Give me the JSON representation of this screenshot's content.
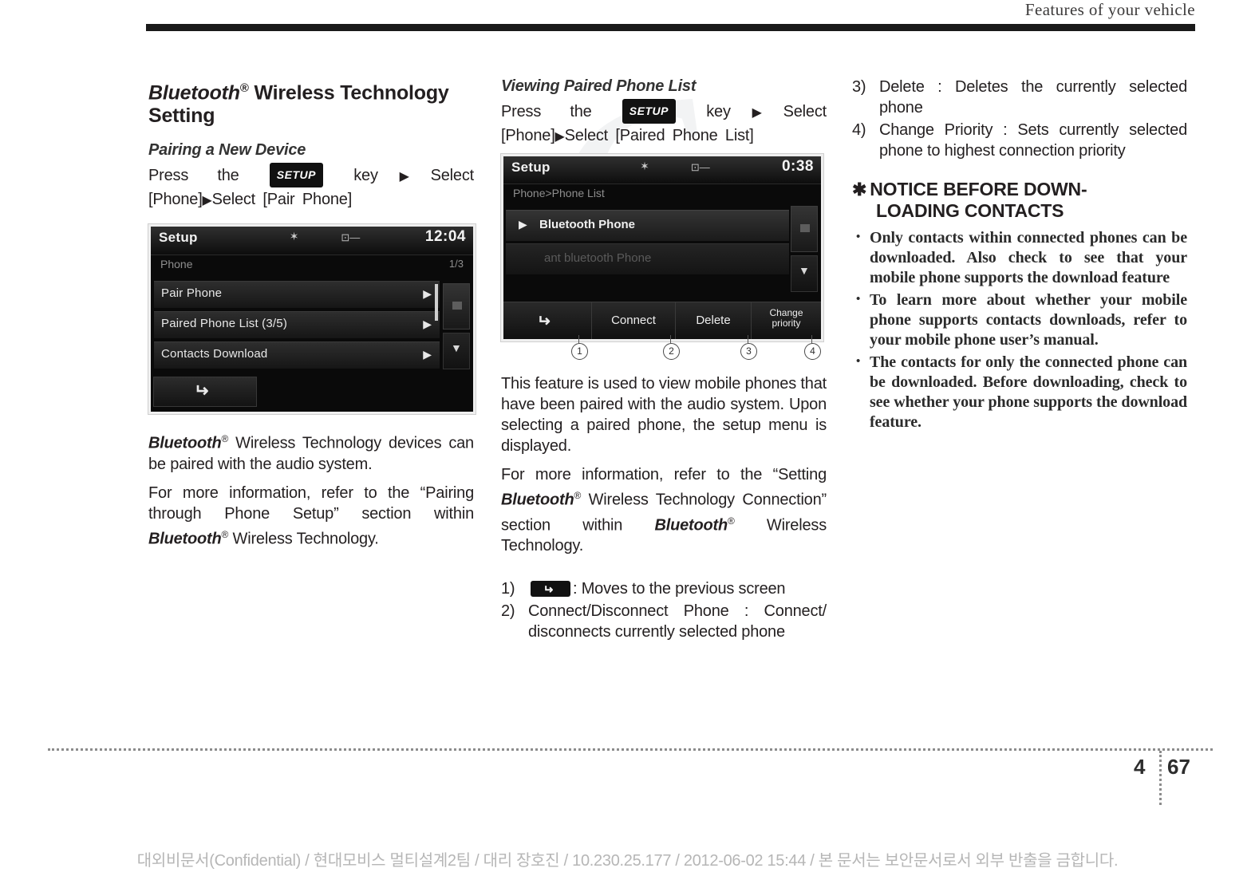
{
  "header": {
    "title": "Features of your vehicle"
  },
  "watermark": {
    "text": "G"
  },
  "col1": {
    "section_title_part1": "Bluetooth",
    "section_title_reg": "®",
    "section_title_part2": " Wireless Technology Setting",
    "sub_title": "Pairing a New Device",
    "instruction": {
      "lead": "Press",
      "the": "the",
      "key_chip": "SETUP",
      "after_chip": "key",
      "arrow1": "▶",
      "select1": "Select [Phone]",
      "arrow2": "▶",
      "select2": "Select [Pair Phone]"
    },
    "screen": {
      "title": "Setup",
      "bt_icon": "bluetooth-icon",
      "usb_icon": "usb-icon",
      "clock": "12:04",
      "breadcrumb": "Phone",
      "page_indicator": "1/3",
      "rows": [
        {
          "label": "Pair Phone",
          "arrow": "▶"
        },
        {
          "label": "Paired Phone List (3/5)",
          "arrow": "▶"
        },
        {
          "label": "Contacts Download",
          "arrow": "▶"
        }
      ],
      "back_icon": "back-arrow-icon"
    },
    "para1": {
      "bt": "Bluetooth",
      "sup": "®",
      "rest": " Wireless Technology devices can be paired with the audio system."
    },
    "para2": {
      "a": "For more information, refer to the “Pairing through Phone Setup” section within ",
      "bt": "Bluetooth",
      "sup": "®",
      "b": " Wireless Technology."
    }
  },
  "col2": {
    "sub_title": "Viewing Paired Phone List",
    "instruction": {
      "lead": "Press",
      "the": "the",
      "key_chip": "SETUP",
      "after_chip": "key",
      "arrow1": "▶",
      "select1": "Select [Phone]",
      "arrow2": "▶",
      "select2": "Select [Paired Phone List]"
    },
    "screen": {
      "title": "Setup",
      "bt_icon": "bluetooth-icon",
      "usb_icon": "usb-icon",
      "clock": "0:38",
      "breadcrumb": "Phone>Phone List",
      "rows": [
        {
          "tri": "▶",
          "label": "Bluetooth Phone",
          "state": "selected"
        },
        {
          "tri": "",
          "label": "ant bluetooth Phone",
          "state": "dim"
        }
      ],
      "softkeys": [
        {
          "label": "",
          "icon": "back-arrow-icon"
        },
        {
          "label": "Connect",
          "icon": ""
        },
        {
          "label": "Delete",
          "icon": ""
        },
        {
          "label": "Change\npriority",
          "icon": ""
        }
      ],
      "callouts": [
        "1",
        "2",
        "3",
        "4"
      ]
    },
    "para1": "This feature is used to view mobile phones that have been paired with the audio system. Upon selecting a paired phone, the setup menu is displayed.",
    "para2": {
      "a": "For more information, refer to the “Setting ",
      "bt1": "Bluetooth",
      "sup1": "®",
      "b": " Wireless Technology Connection” section within ",
      "bt2": "Bluetooth",
      "sup2": "®",
      "c": " Wireless Technology."
    },
    "numbered": [
      {
        "num": "1)",
        "icon": "back-arrow-icon",
        "text": ": Moves to the previous screen"
      },
      {
        "num": "2)",
        "icon": "",
        "text": "Connect/Disconnect Phone : Connect/ disconnects currently selected phone"
      }
    ]
  },
  "col3": {
    "numbered": [
      {
        "num": "3)",
        "text": "Delete : Deletes the currently selected phone"
      },
      {
        "num": "4)",
        "text": "Change Priority : Sets currently selected phone to highest connection priority"
      }
    ],
    "notice_star": "✱",
    "notice_title_line1": "NOTICE BEFORE DOWN-",
    "notice_title_line2": "LOADING CONTACTS",
    "notice_items": [
      "Only contacts within connected phones can be downloaded. Also check to see that your mobile phone supports the download feature",
      "To learn more about whether your mobile phone supports contacts downloads, refer to your mobile phone user’s manual.",
      "The contacts for only the connected phone can be downloaded. Before downloading, check to see whether your phone supports the download feature."
    ]
  },
  "footer": {
    "chapter": "4",
    "page": "67",
    "confidential": "대외비문서(Confidential) / 현대모비스 멀티설계2팀 / 대리 장호진 / 10.230.25.177 / 2012-06-02 15:44 /  본 문서는 보안문서로서 외부 반출을 금합니다."
  }
}
